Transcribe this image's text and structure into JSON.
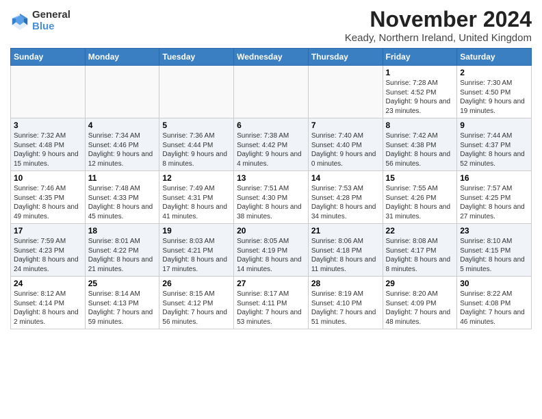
{
  "logo": {
    "general": "General",
    "blue": "Blue"
  },
  "title": "November 2024",
  "subtitle": "Keady, Northern Ireland, United Kingdom",
  "headers": [
    "Sunday",
    "Monday",
    "Tuesday",
    "Wednesday",
    "Thursday",
    "Friday",
    "Saturday"
  ],
  "weeks": [
    [
      {
        "day": "",
        "info": ""
      },
      {
        "day": "",
        "info": ""
      },
      {
        "day": "",
        "info": ""
      },
      {
        "day": "",
        "info": ""
      },
      {
        "day": "",
        "info": ""
      },
      {
        "day": "1",
        "info": "Sunrise: 7:28 AM\nSunset: 4:52 PM\nDaylight: 9 hours and 23 minutes."
      },
      {
        "day": "2",
        "info": "Sunrise: 7:30 AM\nSunset: 4:50 PM\nDaylight: 9 hours and 19 minutes."
      }
    ],
    [
      {
        "day": "3",
        "info": "Sunrise: 7:32 AM\nSunset: 4:48 PM\nDaylight: 9 hours and 15 minutes."
      },
      {
        "day": "4",
        "info": "Sunrise: 7:34 AM\nSunset: 4:46 PM\nDaylight: 9 hours and 12 minutes."
      },
      {
        "day": "5",
        "info": "Sunrise: 7:36 AM\nSunset: 4:44 PM\nDaylight: 9 hours and 8 minutes."
      },
      {
        "day": "6",
        "info": "Sunrise: 7:38 AM\nSunset: 4:42 PM\nDaylight: 9 hours and 4 minutes."
      },
      {
        "day": "7",
        "info": "Sunrise: 7:40 AM\nSunset: 4:40 PM\nDaylight: 9 hours and 0 minutes."
      },
      {
        "day": "8",
        "info": "Sunrise: 7:42 AM\nSunset: 4:38 PM\nDaylight: 8 hours and 56 minutes."
      },
      {
        "day": "9",
        "info": "Sunrise: 7:44 AM\nSunset: 4:37 PM\nDaylight: 8 hours and 52 minutes."
      }
    ],
    [
      {
        "day": "10",
        "info": "Sunrise: 7:46 AM\nSunset: 4:35 PM\nDaylight: 8 hours and 49 minutes."
      },
      {
        "day": "11",
        "info": "Sunrise: 7:48 AM\nSunset: 4:33 PM\nDaylight: 8 hours and 45 minutes."
      },
      {
        "day": "12",
        "info": "Sunrise: 7:49 AM\nSunset: 4:31 PM\nDaylight: 8 hours and 41 minutes."
      },
      {
        "day": "13",
        "info": "Sunrise: 7:51 AM\nSunset: 4:30 PM\nDaylight: 8 hours and 38 minutes."
      },
      {
        "day": "14",
        "info": "Sunrise: 7:53 AM\nSunset: 4:28 PM\nDaylight: 8 hours and 34 minutes."
      },
      {
        "day": "15",
        "info": "Sunrise: 7:55 AM\nSunset: 4:26 PM\nDaylight: 8 hours and 31 minutes."
      },
      {
        "day": "16",
        "info": "Sunrise: 7:57 AM\nSunset: 4:25 PM\nDaylight: 8 hours and 27 minutes."
      }
    ],
    [
      {
        "day": "17",
        "info": "Sunrise: 7:59 AM\nSunset: 4:23 PM\nDaylight: 8 hours and 24 minutes."
      },
      {
        "day": "18",
        "info": "Sunrise: 8:01 AM\nSunset: 4:22 PM\nDaylight: 8 hours and 21 minutes."
      },
      {
        "day": "19",
        "info": "Sunrise: 8:03 AM\nSunset: 4:21 PM\nDaylight: 8 hours and 17 minutes."
      },
      {
        "day": "20",
        "info": "Sunrise: 8:05 AM\nSunset: 4:19 PM\nDaylight: 8 hours and 14 minutes."
      },
      {
        "day": "21",
        "info": "Sunrise: 8:06 AM\nSunset: 4:18 PM\nDaylight: 8 hours and 11 minutes."
      },
      {
        "day": "22",
        "info": "Sunrise: 8:08 AM\nSunset: 4:17 PM\nDaylight: 8 hours and 8 minutes."
      },
      {
        "day": "23",
        "info": "Sunrise: 8:10 AM\nSunset: 4:15 PM\nDaylight: 8 hours and 5 minutes."
      }
    ],
    [
      {
        "day": "24",
        "info": "Sunrise: 8:12 AM\nSunset: 4:14 PM\nDaylight: 8 hours and 2 minutes."
      },
      {
        "day": "25",
        "info": "Sunrise: 8:14 AM\nSunset: 4:13 PM\nDaylight: 7 hours and 59 minutes."
      },
      {
        "day": "26",
        "info": "Sunrise: 8:15 AM\nSunset: 4:12 PM\nDaylight: 7 hours and 56 minutes."
      },
      {
        "day": "27",
        "info": "Sunrise: 8:17 AM\nSunset: 4:11 PM\nDaylight: 7 hours and 53 minutes."
      },
      {
        "day": "28",
        "info": "Sunrise: 8:19 AM\nSunset: 4:10 PM\nDaylight: 7 hours and 51 minutes."
      },
      {
        "day": "29",
        "info": "Sunrise: 8:20 AM\nSunset: 4:09 PM\nDaylight: 7 hours and 48 minutes."
      },
      {
        "day": "30",
        "info": "Sunrise: 8:22 AM\nSunset: 4:08 PM\nDaylight: 7 hours and 46 minutes."
      }
    ]
  ]
}
